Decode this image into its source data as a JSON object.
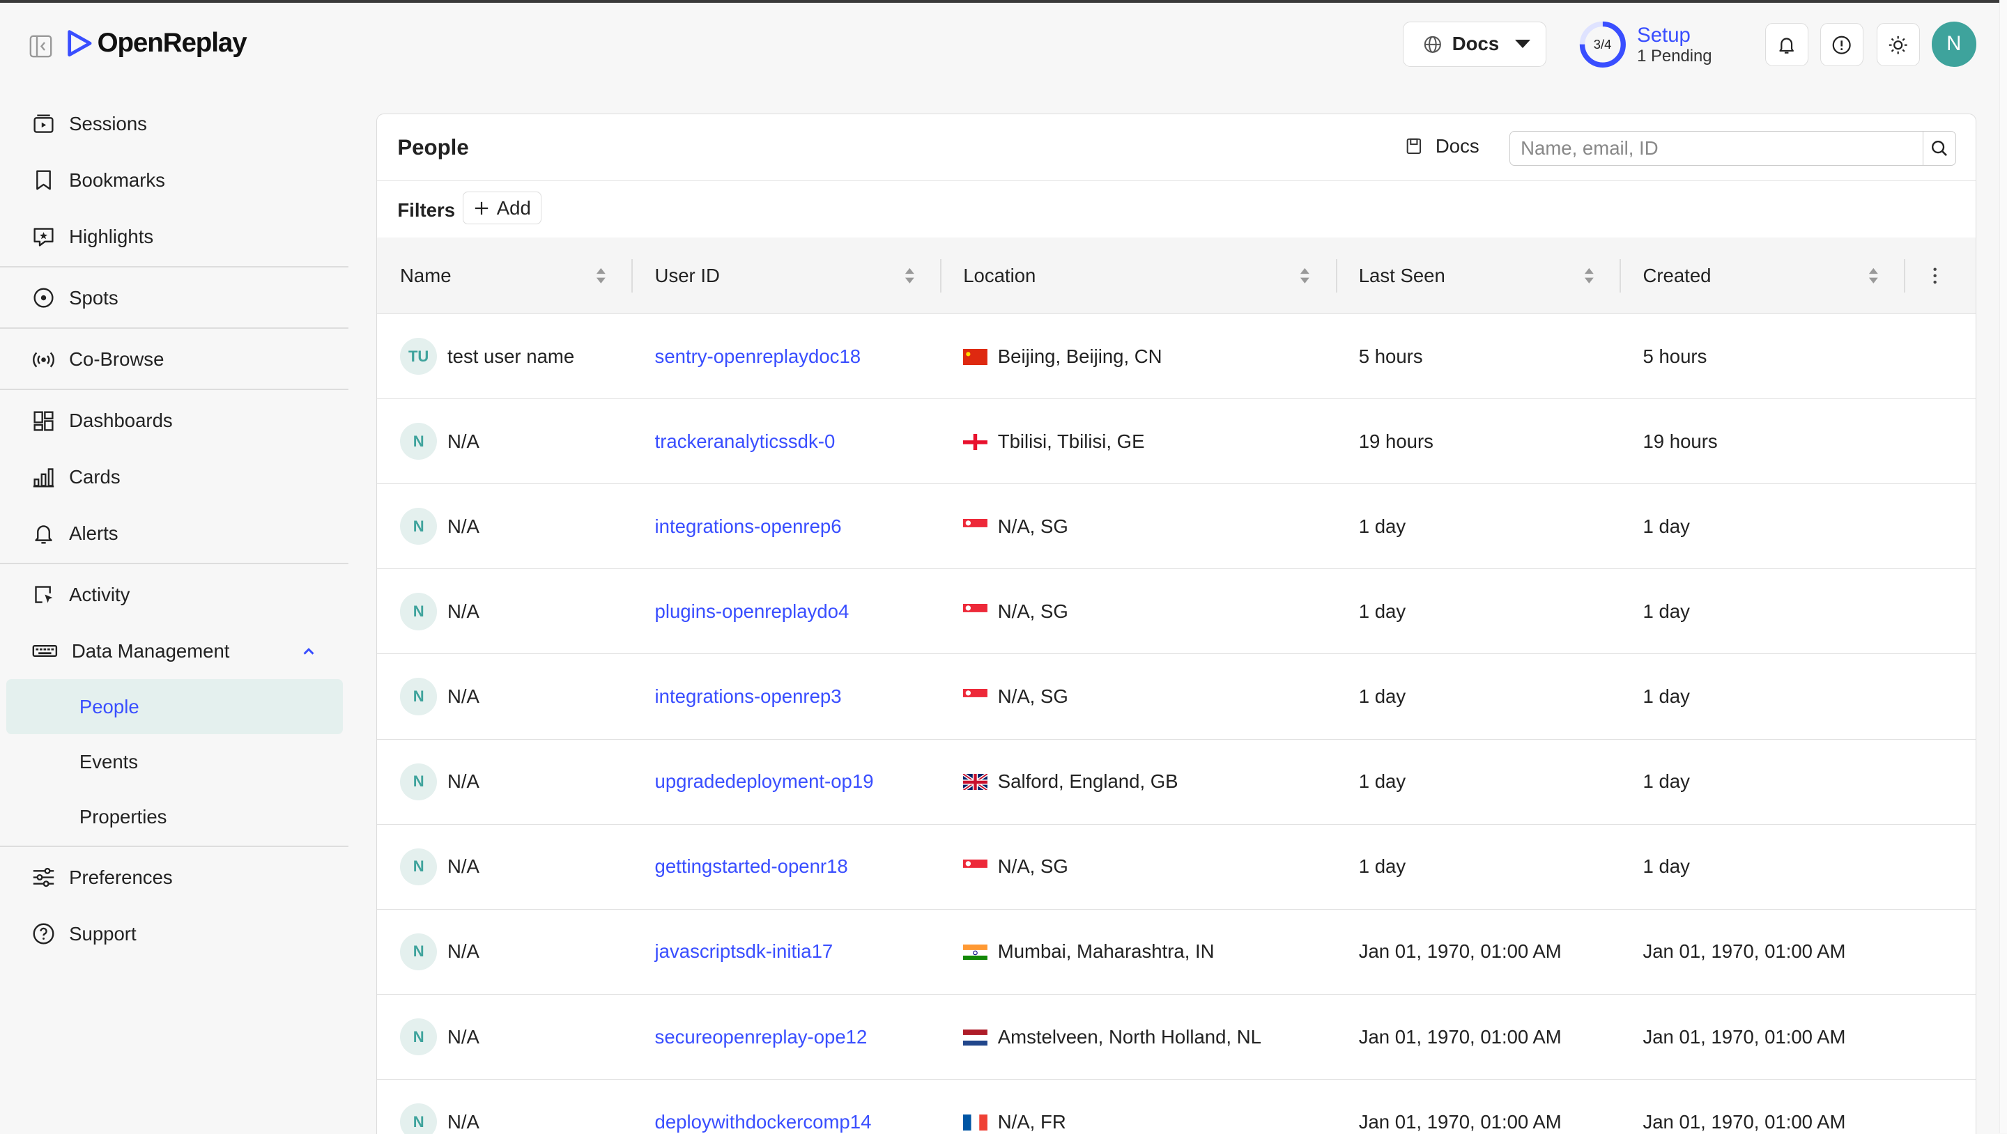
{
  "app": {
    "name": "OpenReplay"
  },
  "header": {
    "docs_label": "Docs",
    "setup": {
      "title": "Setup",
      "progress": "3/4",
      "progress_fraction": 0.75,
      "pending": "1 Pending"
    },
    "avatar_initial": "N"
  },
  "sidebar": {
    "items": [
      {
        "label": "Sessions",
        "icon": "sessions-icon"
      },
      {
        "label": "Bookmarks",
        "icon": "bookmark-icon"
      },
      {
        "label": "Highlights",
        "icon": "highlight-icon"
      },
      {
        "label": "Spots",
        "icon": "spot-icon"
      },
      {
        "label": "Co-Browse",
        "icon": "broadcast-icon"
      },
      {
        "label": "Dashboards",
        "icon": "dashboard-icon"
      },
      {
        "label": "Cards",
        "icon": "bar-chart-icon"
      },
      {
        "label": "Alerts",
        "icon": "bell-icon"
      },
      {
        "label": "Activity",
        "icon": "activity-icon"
      },
      {
        "label": "Data Management",
        "icon": "keyboard-icon"
      },
      {
        "label": "Preferences",
        "icon": "sliders-icon"
      },
      {
        "label": "Support",
        "icon": "help-icon"
      }
    ],
    "data_management_sub": [
      "People",
      "Events",
      "Properties"
    ],
    "active_sub": "People"
  },
  "people": {
    "title": "People",
    "docs_label": "Docs",
    "search_placeholder": "Name, email, ID",
    "filters_label": "Filters",
    "add_label": "Add",
    "columns": [
      "Name",
      "User ID",
      "Location",
      "Last Seen",
      "Created"
    ],
    "rows": [
      {
        "initials": "TU",
        "name": "test user name",
        "user_id": "sentry-openreplaydoc18",
        "country": "CN",
        "location": "Beijing, Beijing, CN",
        "last_seen": "5 hours",
        "created": "5 hours"
      },
      {
        "initials": "N",
        "name": "N/A",
        "user_id": "trackeranalyticssdk-0",
        "country": "GE",
        "location": "Tbilisi, Tbilisi, GE",
        "last_seen": "19 hours",
        "created": "19 hours"
      },
      {
        "initials": "N",
        "name": "N/A",
        "user_id": "integrations-openrep6",
        "country": "SG",
        "location": "N/A, SG",
        "last_seen": "1 day",
        "created": "1 day"
      },
      {
        "initials": "N",
        "name": "N/A",
        "user_id": "plugins-openreplaydo4",
        "country": "SG",
        "location": "N/A, SG",
        "last_seen": "1 day",
        "created": "1 day"
      },
      {
        "initials": "N",
        "name": "N/A",
        "user_id": "integrations-openrep3",
        "country": "SG",
        "location": "N/A, SG",
        "last_seen": "1 day",
        "created": "1 day"
      },
      {
        "initials": "N",
        "name": "N/A",
        "user_id": "upgradedeployment-op19",
        "country": "GB",
        "location": "Salford, England, GB",
        "last_seen": "1 day",
        "created": "1 day"
      },
      {
        "initials": "N",
        "name": "N/A",
        "user_id": "gettingstarted-openr18",
        "country": "SG",
        "location": "N/A, SG",
        "last_seen": "1 day",
        "created": "1 day"
      },
      {
        "initials": "N",
        "name": "N/A",
        "user_id": "javascriptsdk-initia17",
        "country": "IN",
        "location": "Mumbai, Maharashtra, IN",
        "last_seen": "Jan 01, 1970, 01:00 AM",
        "created": "Jan 01, 1970, 01:00 AM"
      },
      {
        "initials": "N",
        "name": "N/A",
        "user_id": "secureopenreplay-ope12",
        "country": "NL",
        "location": "Amstelveen, North Holland, NL",
        "last_seen": "Jan 01, 1970, 01:00 AM",
        "created": "Jan 01, 1970, 01:00 AM"
      },
      {
        "initials": "N",
        "name": "N/A",
        "user_id": "deploywithdockercomp14",
        "country": "FR",
        "location": "N/A, FR",
        "last_seen": "Jan 01, 1970, 01:00 AM",
        "created": "Jan 01, 1970, 01:00 AM"
      }
    ]
  },
  "colors": {
    "accent": "#394eff",
    "teal": "#3ea39c",
    "active_bg": "#e4f0ee"
  }
}
